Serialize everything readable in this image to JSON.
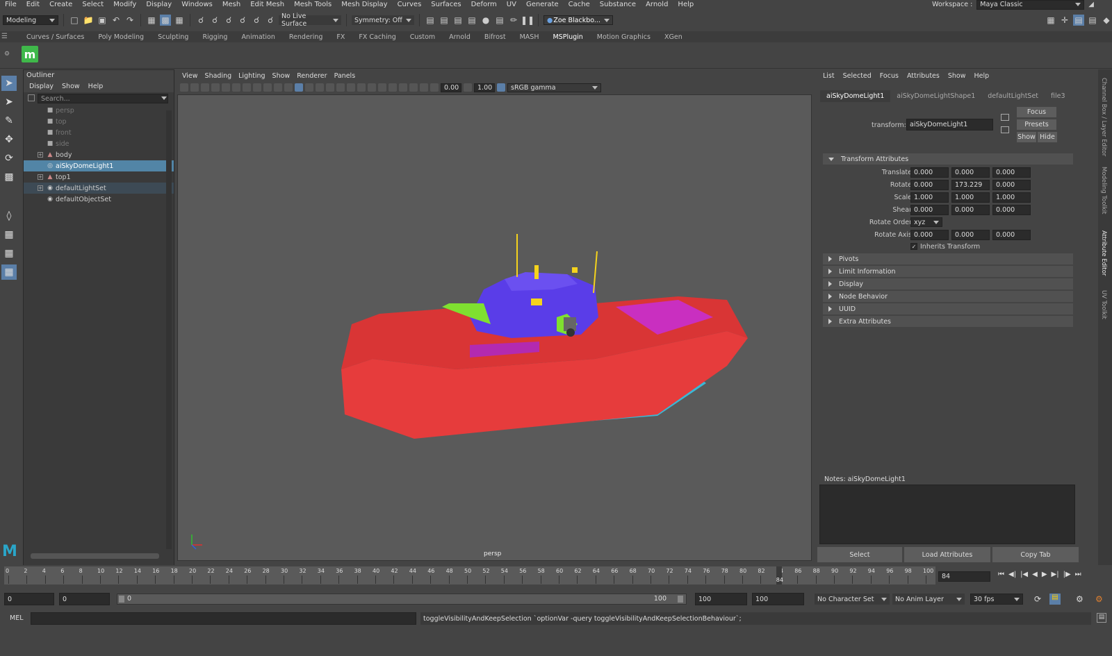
{
  "menubar": [
    "File",
    "Edit",
    "Create",
    "Select",
    "Modify",
    "Display",
    "Windows",
    "Mesh",
    "Edit Mesh",
    "Mesh Tools",
    "Mesh Display",
    "Curves",
    "Surfaces",
    "Deform",
    "UV",
    "Generate",
    "Cache",
    "Substance",
    "Arnold",
    "Help"
  ],
  "workspace": {
    "label": "Workspace :",
    "value": "Maya Classic"
  },
  "statusline": {
    "mode": "Modeling",
    "live_surface": "No Live Surface",
    "symmetry": "Symmetry: Off",
    "user": "Zoe Blackbo..."
  },
  "shelf_tabs": [
    "Curves / Surfaces",
    "Poly Modeling",
    "Sculpting",
    "Rigging",
    "Animation",
    "Rendering",
    "FX",
    "FX Caching",
    "Custom",
    "Arnold",
    "Bifrost",
    "MASH",
    "MSPlugin",
    "Motion Graphics",
    "XGen"
  ],
  "shelf_active": "MSPlugin",
  "outliner": {
    "title": "Outliner",
    "menu": [
      "Display",
      "Show",
      "Help"
    ],
    "search_placeholder": "Search...",
    "items": [
      {
        "label": "persp",
        "dim": true,
        "expand": false,
        "icon": "camera"
      },
      {
        "label": "top",
        "dim": true,
        "expand": false,
        "icon": "camera"
      },
      {
        "label": "front",
        "dim": true,
        "expand": false,
        "icon": "camera"
      },
      {
        "label": "side",
        "dim": true,
        "expand": false,
        "icon": "camera"
      },
      {
        "label": "body",
        "dim": false,
        "expand": true,
        "icon": "mesh"
      },
      {
        "label": "aiSkyDomeLight1",
        "dim": false,
        "expand": false,
        "icon": "light",
        "selected": true
      },
      {
        "label": "top1",
        "dim": false,
        "expand": true,
        "icon": "mesh"
      },
      {
        "label": "defaultLightSet",
        "dim": false,
        "expand": true,
        "icon": "set",
        "highlight": true
      },
      {
        "label": "defaultObjectSet",
        "dim": false,
        "expand": false,
        "icon": "set"
      }
    ]
  },
  "viewport": {
    "menu": [
      "View",
      "Shading",
      "Lighting",
      "Show",
      "Renderer",
      "Panels"
    ],
    "exposure": "0.00",
    "gamma": "1.00",
    "colorspace": "sRGB gamma",
    "camera_label": "persp"
  },
  "attr": {
    "menu": [
      "List",
      "Selected",
      "Focus",
      "Attributes",
      "Show",
      "Help"
    ],
    "tabs": [
      "aiSkyDomeLight1",
      "aiSkyDomeLightShape1",
      "defaultLightSet",
      "file3"
    ],
    "transform_label": "transform:",
    "transform_value": "aiSkyDomeLight1",
    "focus": "Focus",
    "presets": "Presets",
    "show": "Show",
    "hide": "Hide",
    "section_transform": "Transform Attributes",
    "rows": [
      {
        "label": "Translate",
        "v": [
          "0.000",
          "0.000",
          "0.000"
        ]
      },
      {
        "label": "Rotate",
        "v": [
          "0.000",
          "173.229",
          "0.000"
        ]
      },
      {
        "label": "Scale",
        "v": [
          "1.000",
          "1.000",
          "1.000"
        ]
      },
      {
        "label": "Shear",
        "v": [
          "0.000",
          "0.000",
          "0.000"
        ]
      }
    ],
    "rotate_order_label": "Rotate Order",
    "rotate_order": "xyz",
    "rotate_axis_label": "Rotate Axis",
    "rotate_axis": [
      "0.000",
      "0.000",
      "0.000"
    ],
    "inherits": "Inherits Transform",
    "sections": [
      "Pivots",
      "Limit Information",
      "Display",
      "Node Behavior",
      "UUID",
      "Extra Attributes"
    ],
    "notes": "Notes:  aiSkyDomeLight1",
    "buttons": [
      "Select",
      "Load Attributes",
      "Copy Tab"
    ]
  },
  "side_tabs": [
    "Channel Box / Layer Editor",
    "Modeling Toolkit",
    "Attribute Editor",
    "UV Toolkit"
  ],
  "timeline": {
    "ticks": [
      "0",
      "2",
      "4",
      "6",
      "8",
      "10",
      "12",
      "14",
      "16",
      "18",
      "20",
      "22",
      "24",
      "26",
      "28",
      "30",
      "32",
      "34",
      "36",
      "38",
      "40",
      "42",
      "44",
      "46",
      "48",
      "50",
      "52",
      "54",
      "56",
      "58",
      "60",
      "62",
      "64",
      "66",
      "68",
      "70",
      "72",
      "74",
      "76",
      "78",
      "80",
      "82",
      "84",
      "86",
      "88",
      "90",
      "92",
      "94",
      "96",
      "98",
      "100"
    ],
    "current": "84",
    "current_frame": 84,
    "frame_field": "84"
  },
  "range": {
    "start_a": "0",
    "start_b": "0",
    "slider_start": "0",
    "slider_end": "100",
    "end_a": "100",
    "end_b": "100",
    "character": "No Character Set",
    "anim_layer": "No Anim Layer",
    "fps": "30 fps"
  },
  "cmd": {
    "lang": "MEL",
    "feedback": "toggleVisibilityAndKeepSelection `optionVar -query toggleVisibilityAndKeepSelectionBehaviour`;"
  }
}
